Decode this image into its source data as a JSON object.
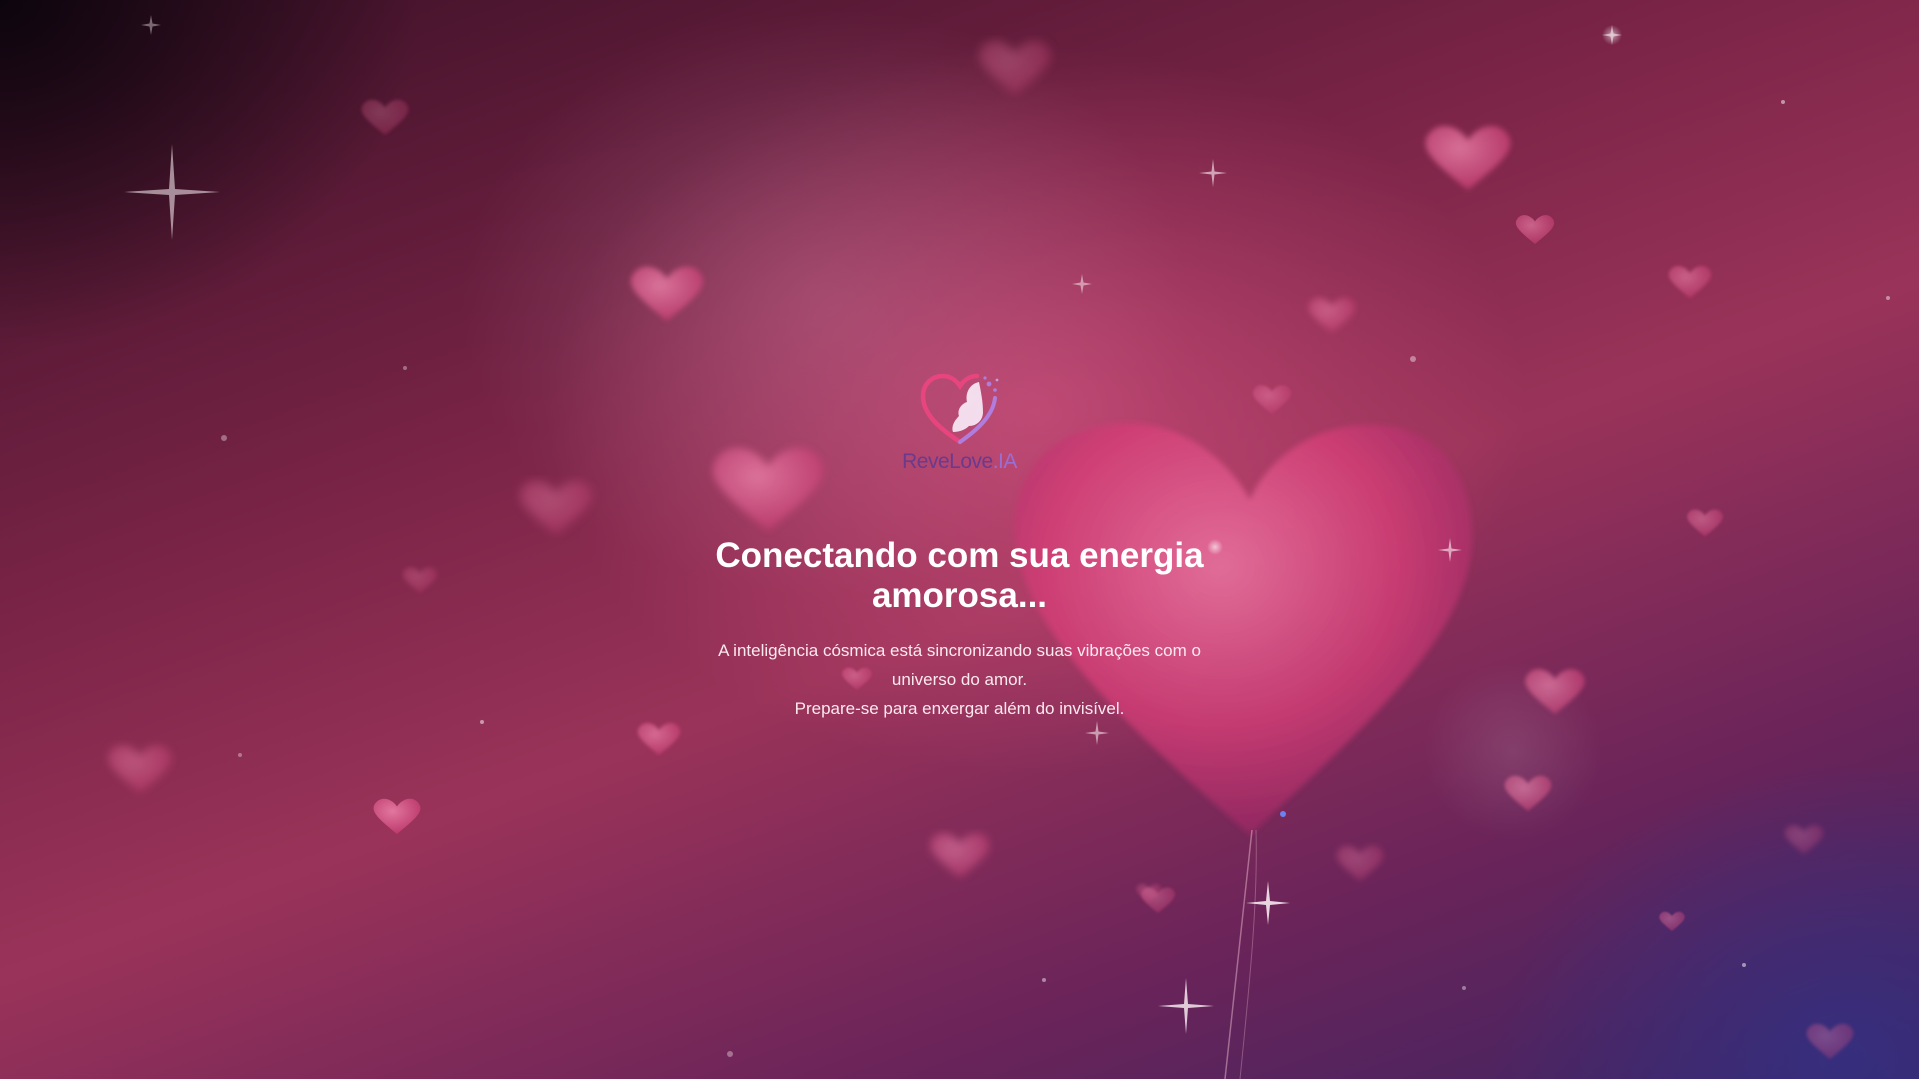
{
  "brand": {
    "name_main": "ReveLove",
    "name_suffix": ".IA",
    "logo_icon": "heart-woman-profile-icon"
  },
  "loading": {
    "title": "Conectando com sua energia amorosa...",
    "description_line1": "A inteligência cósmica está sincronizando suas vibrações com o universo do amor.",
    "description_line2": "Prepare-se para enxergar além do invisível."
  },
  "colors": {
    "background_primary": "#9a3359",
    "background_dark": "#3a1026",
    "background_accent_blue": "#3c2463",
    "heart_pink": "#e0457d",
    "logo_purple": "#6a3a8e",
    "logo_lilac": "#9a6fd4",
    "text_white": "#ffffff"
  },
  "decorations": {
    "background_icons": [
      "heart-icon",
      "sparkle-icon",
      "heart-balloon-icon"
    ]
  }
}
